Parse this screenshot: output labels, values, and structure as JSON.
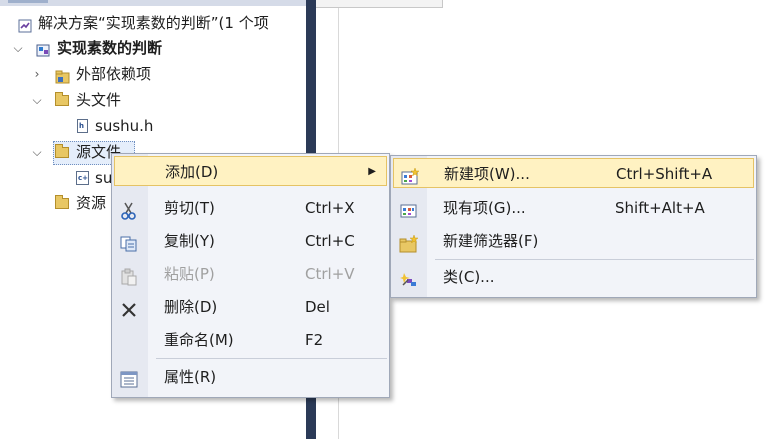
{
  "solution_explorer": {
    "solution_label": "解决方案“实现素数的判断”(1 个项",
    "project_label": "实现素数的判断",
    "items": [
      {
        "label": "外部依赖项"
      },
      {
        "label": "头文件"
      },
      {
        "label": "sushu.h"
      },
      {
        "label": "源文件"
      },
      {
        "label": "su"
      },
      {
        "label": "资源"
      }
    ]
  },
  "context_menu": {
    "add": {
      "label": "添加(D)"
    },
    "cut": {
      "label": "剪切(T)",
      "shortcut": "Ctrl+X"
    },
    "copy": {
      "label": "复制(Y)",
      "shortcut": "Ctrl+C"
    },
    "paste": {
      "label": "粘贴(P)",
      "shortcut": "Ctrl+V"
    },
    "delete": {
      "label": "删除(D)",
      "shortcut": "Del"
    },
    "rename": {
      "label": "重命名(M)",
      "shortcut": "F2"
    },
    "properties": {
      "label": "属性(R)"
    }
  },
  "add_submenu": {
    "new_item": {
      "label": "新建项(W)...",
      "shortcut": "Ctrl+Shift+A"
    },
    "existing_item": {
      "label": "现有项(G)...",
      "shortcut": "Shift+Alt+A"
    },
    "new_filter": {
      "label": "新建筛选器(F)"
    },
    "class": {
      "label": "类(C)..."
    }
  },
  "icons": {
    "add": "none",
    "cut": "scissors-icon",
    "copy": "copy-icon",
    "paste": "paste-icon",
    "delete": "delete-x-icon",
    "properties": "properties-icon",
    "new_item": "new-item-icon",
    "existing_item": "existing-item-icon",
    "new_filter": "new-filter-folder-icon",
    "class": "class-wizard-icon"
  },
  "colors": {
    "highlight": "#fff2c2",
    "splitter": "#2b3a57",
    "menu_bg": "#f2f4f9"
  }
}
